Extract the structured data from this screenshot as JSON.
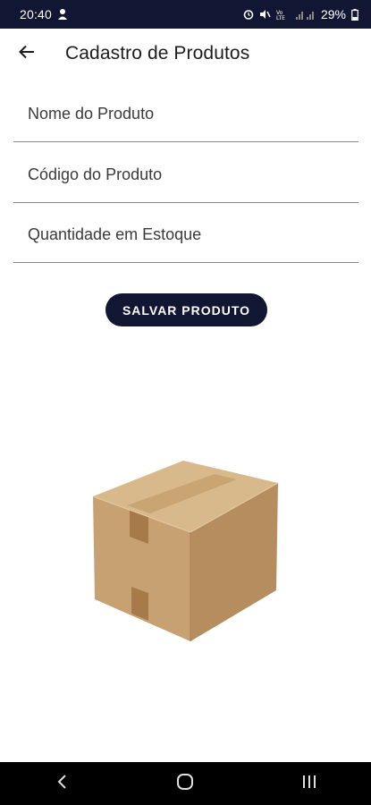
{
  "status_bar": {
    "time": "20:40",
    "battery": "29%",
    "icons": [
      "person-pin-icon",
      "alarm-icon",
      "mute-icon",
      "volte-icon",
      "signal-icon",
      "battery-icon"
    ]
  },
  "app_bar": {
    "title": "Cadastro de Produtos",
    "back_icon": "arrow-back-icon"
  },
  "form": {
    "name_field": {
      "placeholder": "Nome do Produto",
      "value": ""
    },
    "code_field": {
      "placeholder": "Código do Produto",
      "value": ""
    },
    "quantity_field": {
      "placeholder": "Quantidade em Estoque",
      "value": ""
    },
    "save_label": "SALVAR PRODUTO"
  },
  "illustration": "cardboard-box",
  "nav_bar": {
    "buttons": [
      "back-nav-icon",
      "home-nav-icon",
      "recents-nav-icon"
    ]
  },
  "colors": {
    "primary": "#111633",
    "on_primary": "#ffffff",
    "background": "#ffffff",
    "divider": "#8a8a8a",
    "box_tan": "#cfa97a"
  }
}
